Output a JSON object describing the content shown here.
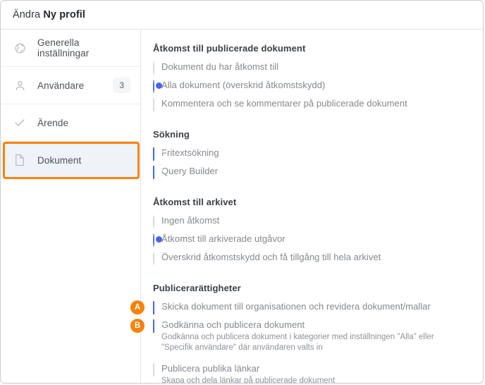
{
  "header": {
    "prefix": "Ändra ",
    "profile_name": "Ny profil"
  },
  "colors": {
    "accent_blue": "#4963ec",
    "marker_orange": "#f6820c",
    "highlight_border": "#f68410",
    "selected_row_bg": "#eef3f8"
  },
  "sidebar": {
    "items": [
      {
        "icon": "globe-icon",
        "label": "Generella inställningar",
        "count": "",
        "selected": false
      },
      {
        "icon": "user-icon",
        "label": "Användare",
        "count": "3",
        "selected": false
      },
      {
        "icon": "check-icon",
        "label": "Ärende",
        "count": "",
        "selected": false
      },
      {
        "icon": "document-icon",
        "label": "Dokument",
        "count": "",
        "selected": true
      }
    ]
  },
  "main": {
    "sections": [
      {
        "heading": "Åtkomst till publicerade dokument",
        "options": [
          {
            "type": "radio",
            "checked": false,
            "label": "Dokument du har åtkomst till",
            "sub": "",
            "marker": ""
          },
          {
            "type": "radio",
            "checked": true,
            "label": "Alla dokument (överskrid åtkomstskydd)",
            "sub": "",
            "marker": ""
          },
          {
            "type": "checkbox",
            "checked": false,
            "label": "Kommentera och se kommentarer på publicerade dokument",
            "sub": "",
            "marker": ""
          }
        ]
      },
      {
        "heading": "Sökning",
        "options": [
          {
            "type": "checkbox",
            "checked": true,
            "label": "Fritextsökning",
            "sub": "",
            "marker": ""
          },
          {
            "type": "checkbox",
            "checked": true,
            "label": "Query Builder",
            "sub": "",
            "marker": ""
          }
        ]
      },
      {
        "heading": "Åtkomst till arkivet",
        "options": [
          {
            "type": "radio",
            "checked": false,
            "label": "Ingen åtkomst",
            "sub": "",
            "marker": ""
          },
          {
            "type": "radio",
            "checked": true,
            "label": "Åtkomst till arkiverade utgåvor",
            "sub": "",
            "marker": ""
          },
          {
            "type": "radio",
            "checked": false,
            "label": "Överskrid åtkomstskydd och få tillgång till hela arkivet",
            "sub": "",
            "marker": ""
          }
        ]
      },
      {
        "heading": "Publicerarättigheter",
        "options": [
          {
            "type": "checkbox",
            "checked": true,
            "label": "Skicka dokument till organisationen och revidera dokument/mallar",
            "sub": "",
            "marker": "A"
          },
          {
            "type": "checkbox",
            "checked": true,
            "label": "Godkänna och publicera dokument",
            "sub": "Godkänna och publicera dokument i kategorier med inställningen \"Alla\" eller \"Specifik användare\" där användaren valts in",
            "marker": "B"
          },
          {
            "type": "checkbox",
            "checked": false,
            "label": "Publicera publika länkar",
            "sub": "Skapa och dela länkar på publicerade dokument",
            "marker": "",
            "spaced": true
          }
        ]
      }
    ]
  }
}
